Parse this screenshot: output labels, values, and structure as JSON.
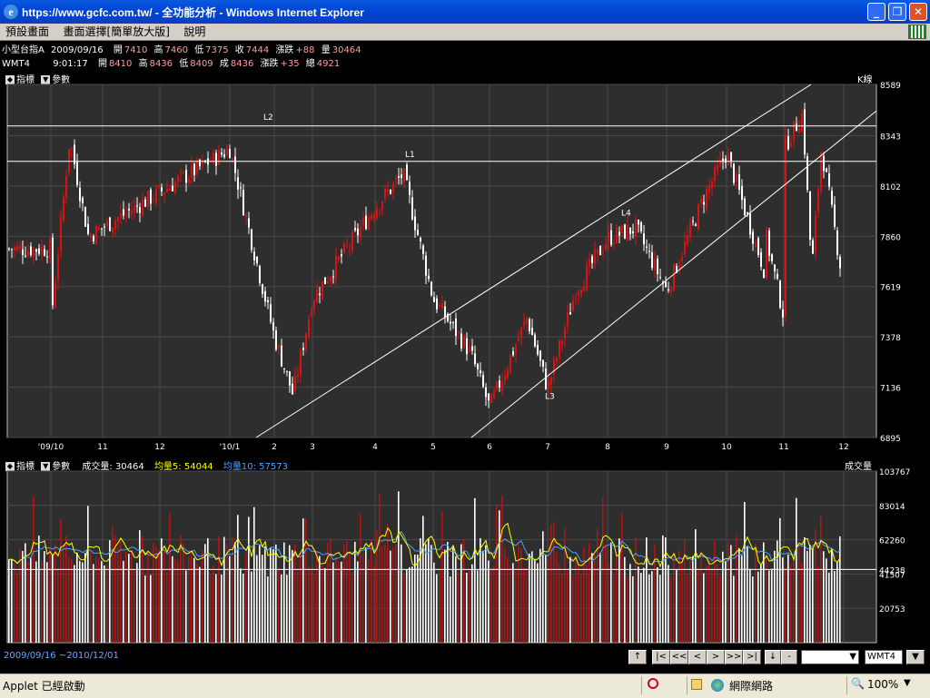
{
  "window": {
    "title": "https://www.gcfc.com.tw/ - 全功能分析 - Windows Internet Explorer",
    "ie_icon": "ie-e-icon",
    "minimize": "_",
    "restore": "❐",
    "close": "✕"
  },
  "menu": [
    "預設畫面",
    "畫面選擇[簡單放大版]",
    "說明"
  ],
  "quotes": [
    {
      "name": "小型台指A",
      "time": "2009/09/16",
      "items": [
        [
          "開",
          "7410"
        ],
        [
          "高",
          "7460"
        ],
        [
          "低",
          "7375"
        ],
        [
          "收",
          "7444"
        ],
        [
          "漲跌",
          "+88"
        ],
        [
          "量",
          "30464"
        ]
      ]
    },
    {
      "name": "WMT4",
      "time": "9:01:17",
      "items": [
        [
          "開",
          "8410"
        ],
        [
          "高",
          "8436"
        ],
        [
          "低",
          "8409"
        ],
        [
          "成",
          "8436"
        ],
        [
          "漲跌",
          "+35"
        ],
        [
          "總",
          "4921"
        ]
      ]
    }
  ],
  "price_panel": {
    "header_indicator": "指標",
    "header_params": "參數",
    "label": "K線",
    "colors": {
      "up": "#dd1111",
      "down": "#ffffff",
      "bg": "#2e2e2e",
      "grid": "#4a4a4a"
    }
  },
  "volume_panel": {
    "header_indicator": "指標",
    "header_params": "參數",
    "label": "成交量",
    "legend": [
      {
        "name": "成交量:",
        "value": "30464",
        "color": "#ffffff"
      },
      {
        "name": "均量5:",
        "value": "54044",
        "color": "#ffff00"
      },
      {
        "name": "均量10:",
        "value": "57573",
        "color": "#4aa3ff"
      }
    ]
  },
  "nav": {
    "range": "2009/09/16 ~2010/12/01",
    "buttons": [
      "↑",
      "|<",
      "<<",
      "<",
      ">",
      ">>",
      ">|",
      "↓",
      "-"
    ],
    "symbol": "WMT4",
    "dropdown_arrow": "▼",
    "scroll_down": "▼"
  },
  "status": {
    "text": "Applet 已經啟動",
    "zone": "網際網路",
    "zoom": "100%"
  },
  "chart_data": [
    {
      "type": "candlestick",
      "label": "K線",
      "y_ticks": [
        8589,
        8343,
        8102,
        7860,
        7619,
        7378,
        7136,
        6895
      ],
      "ylim": [
        6895,
        8589
      ],
      "x_ticks": [
        "'09/10",
        "11",
        "12",
        "'10/1",
        "2",
        "3",
        "4",
        "5",
        "6",
        "7",
        "8",
        "9",
        "10",
        "11",
        "12"
      ],
      "annotations": [
        "L2",
        "L1",
        "L4",
        "L3"
      ],
      "horizontal_lines": [
        8390,
        8220
      ],
      "trendlines": [
        {
          "from": [
            "2",
            6895
          ],
          "to": [
            "11",
            8589
          ]
        },
        {
          "from": [
            "6",
            6895
          ],
          "to": [
            "12",
            8462
          ]
        }
      ],
      "close_path": [
        [
          "'09/10",
          7450
        ],
        [
          "10/20",
          7700
        ],
        [
          "11",
          7480
        ],
        [
          "11/15",
          7700
        ],
        [
          "12",
          7620
        ],
        [
          "12/20",
          7800
        ],
        [
          "'10/1",
          8280
        ],
        [
          "1/10",
          8330
        ],
        [
          "1/20",
          7860
        ],
        [
          "2",
          7380
        ],
        [
          "2/10",
          7100
        ],
        [
          "3",
          7560
        ],
        [
          "4",
          8000
        ],
        [
          "4/15",
          8160
        ],
        [
          "5",
          7560
        ],
        [
          "5/20",
          7300
        ],
        [
          "6",
          7040
        ],
        [
          "6/20",
          7470
        ],
        [
          "7",
          7130
        ],
        [
          "7/15",
          7600
        ],
        [
          "8",
          7850
        ],
        [
          "8/15",
          7900
        ],
        [
          "9",
          7600
        ],
        [
          "9/20",
          8050
        ],
        [
          "10",
          8260
        ],
        [
          "10/20",
          7900
        ],
        [
          "11",
          8280
        ],
        [
          "11/10",
          8450
        ],
        [
          "11/20",
          8290
        ],
        [
          "12",
          8430
        ]
      ]
    },
    {
      "type": "bar",
      "label": "成交量",
      "y_ticks": [
        103767,
        83014,
        62260,
        44238,
        41507,
        20753
      ],
      "ylim": [
        0,
        103767
      ],
      "series": [
        {
          "name": "成交量",
          "values": "daily volume bars (red up / white down)"
        },
        {
          "name": "均量5",
          "values": "5-day average line"
        },
        {
          "name": "均量10",
          "values": "10-day average line"
        }
      ],
      "reference_line": 44238
    }
  ]
}
